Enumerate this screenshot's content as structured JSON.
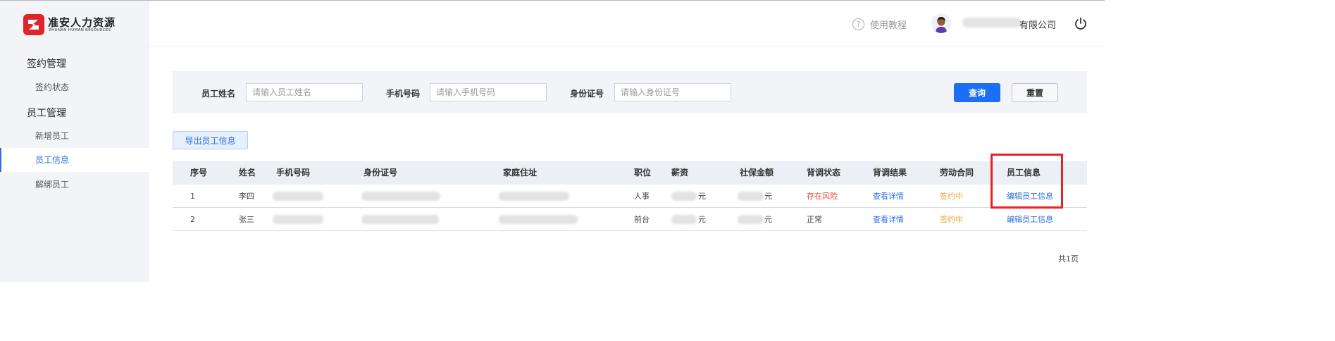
{
  "brand": {
    "name_cn": "准安人力资源",
    "name_en": "ZHUNAN HUMAN RESOURCES",
    "logo_color": "#e0252a"
  },
  "sidebar": {
    "groups": [
      {
        "title": "签约管理",
        "items": [
          {
            "label": "签约状态",
            "active": false
          }
        ]
      },
      {
        "title": "员工管理",
        "items": [
          {
            "label": "新增员工",
            "active": false
          },
          {
            "label": "员工信息",
            "active": true
          },
          {
            "label": "解绑员工",
            "active": false
          }
        ]
      }
    ]
  },
  "header": {
    "help_label": "使用教程",
    "help_icon": "question-circle-icon",
    "company_suffix": "有限公司",
    "power_icon": "power-icon"
  },
  "search": {
    "name_label": "员工姓名",
    "name_placeholder": "请输入员工姓名",
    "phone_label": "手机号码",
    "phone_placeholder": "请输入手机号码",
    "id_label": "身份证号",
    "id_placeholder": "请输入身份证号",
    "query_label": "查询",
    "reset_label": "重置"
  },
  "export_label": "导出员工信息",
  "table": {
    "columns": [
      "序号",
      "姓名",
      "手机号码",
      "身份证号",
      "家庭住址",
      "职位",
      "薪资",
      "社保金额",
      "背调状态",
      "背调结果",
      "劳动合同",
      "员工信息"
    ],
    "rows": [
      {
        "index": "1",
        "name": "李四",
        "position": "人事",
        "salary_suffix": "元",
        "social_suffix": "元",
        "check_status": "存在风险",
        "check_result": "查看详情",
        "contract": "签约中",
        "edit": "编辑员工信息"
      },
      {
        "index": "2",
        "name": "张三",
        "position": "前台",
        "salary_suffix": "元",
        "social_suffix": "元",
        "check_status": "正常",
        "check_result": "查看详情",
        "contract": "签约中",
        "edit": "编辑员工信息"
      }
    ]
  },
  "pager": {
    "total_label": "共1页"
  },
  "colors": {
    "primary": "#1a6ef7",
    "link": "#2b6fe0",
    "risk": "#e0452c",
    "signing": "#f0a33a",
    "highlight": "#e62222"
  }
}
